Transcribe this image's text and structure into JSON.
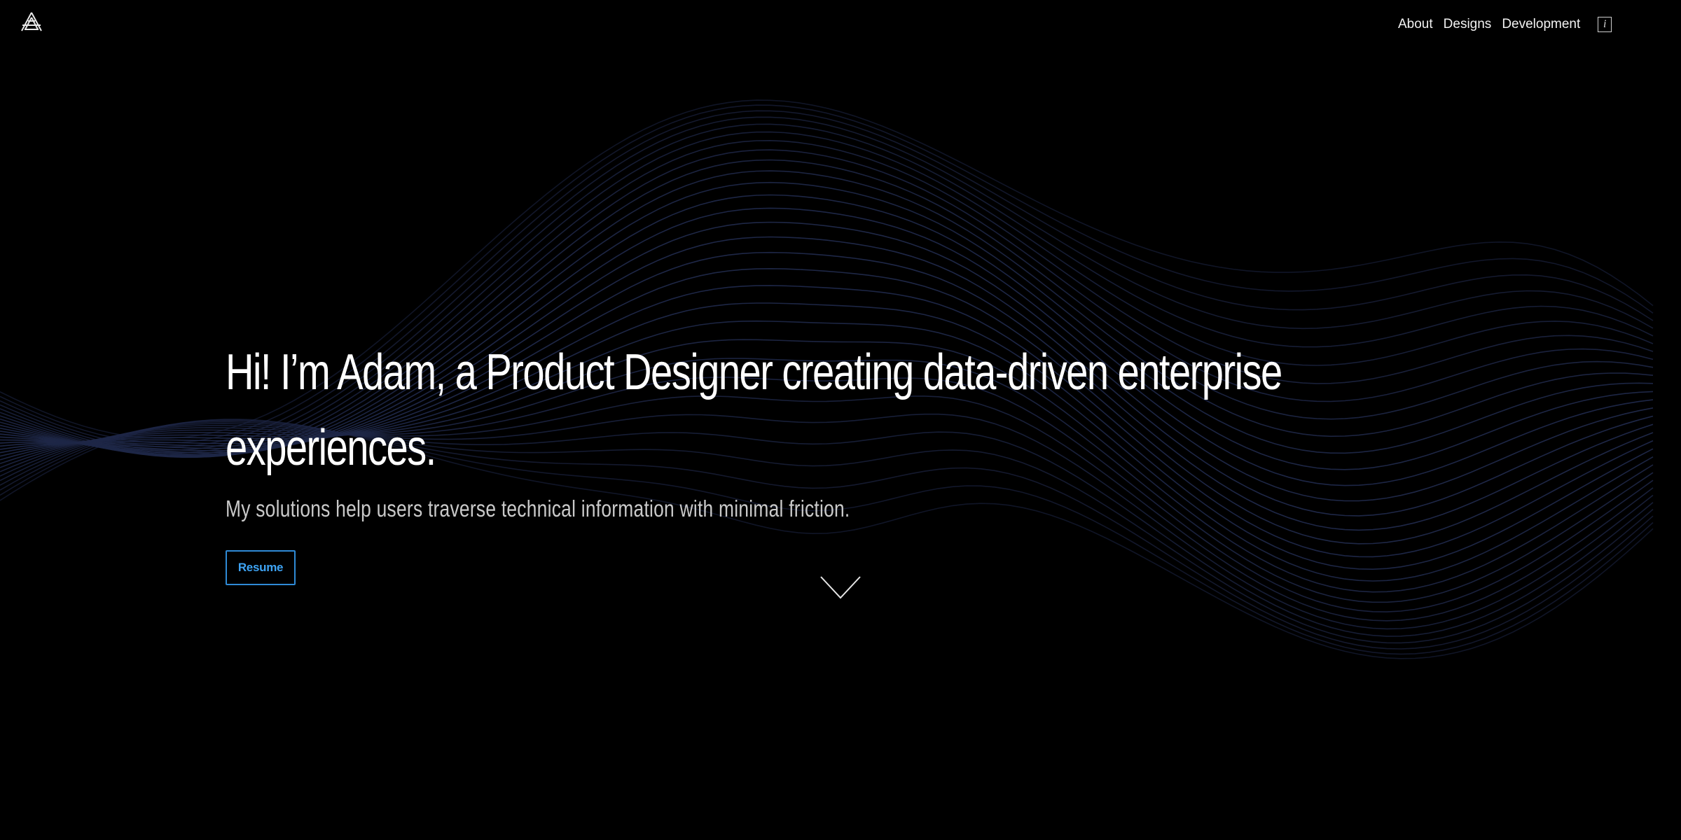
{
  "nav": {
    "items": [
      {
        "label": "About"
      },
      {
        "label": "Designs"
      },
      {
        "label": "Development"
      }
    ],
    "info_icon": "info-icon",
    "info_glyph": "i"
  },
  "logo": {
    "icon": "mountain-logo-icon"
  },
  "hero": {
    "title": "Hi! I’m Adam, a Product Designer creating data-driven enterprise experiences.",
    "subtitle": "My solutions help users traverse technical information with minimal friction.",
    "resume_label": "Resume",
    "scroll_icon": "chevron-down-icon"
  },
  "colors": {
    "background": "#000000",
    "wave_lines": "#1e2747",
    "accent": "#3ea3f3",
    "text": "#ffffff",
    "subtitle": "#c9c9c9"
  }
}
